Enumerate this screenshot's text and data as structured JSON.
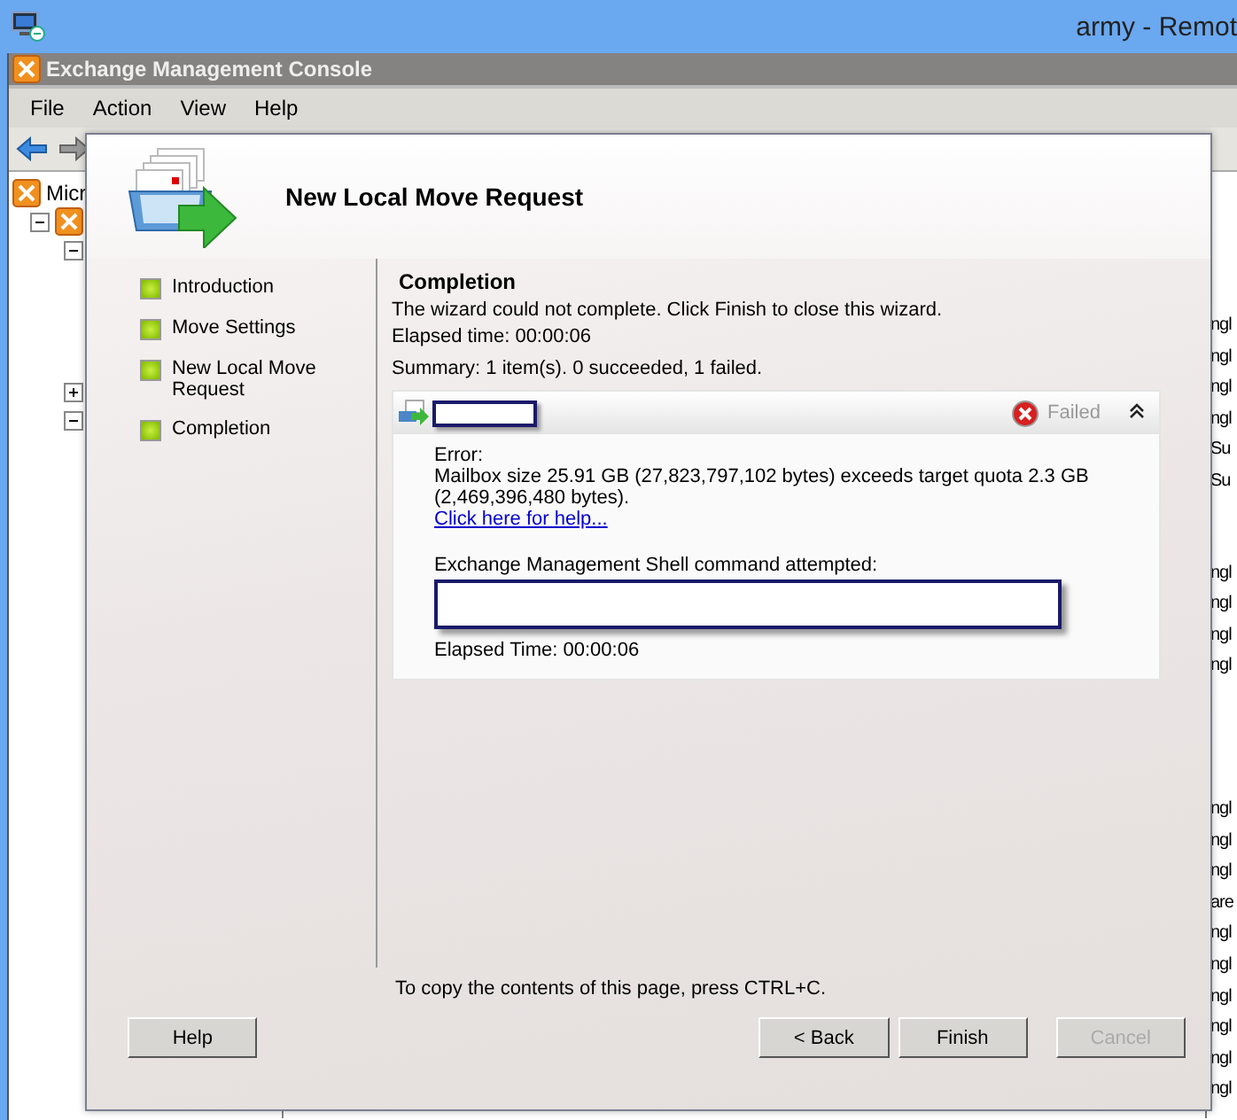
{
  "remote": {
    "title": "army - Remot"
  },
  "console": {
    "title": "Exchange Management Console",
    "menu": [
      "File",
      "Action",
      "View",
      "Help"
    ],
    "tree": {
      "label": "Micr",
      "children": [
        {
          "expanded": true,
          "children": [
            {
              "expanded": true
            },
            {
              "expanded": false
            },
            {
              "expanded": true
            }
          ]
        }
      ]
    },
    "list_fragments": [
      [
        "ngl",
        "ngl",
        "ngl",
        "ngl",
        "Su",
        "Su"
      ],
      [
        "ngl",
        "ngl",
        "ngl",
        "ngl"
      ],
      [
        "ngl",
        "ngl",
        "ngl",
        "are",
        "ngl",
        "ngl",
        "ngl",
        "ngl",
        "ngl",
        "ngl"
      ]
    ]
  },
  "wizard": {
    "title": "New Local Move Request",
    "steps": [
      {
        "label": "Introduction"
      },
      {
        "label": "Move Settings"
      },
      {
        "label": "New Local Move Request"
      },
      {
        "label": "Completion"
      }
    ],
    "heading": "Completion",
    "message": "The wizard could not complete. Click Finish to close this wizard.",
    "elapsed": "Elapsed time: 00:00:06",
    "summary": "Summary: 1 item(s). 0 succeeded, 1 failed.",
    "result": {
      "status": "Failed",
      "expanded": true,
      "error_label": "Error:",
      "error_text": "Mailbox size 25.91 GB (27,823,797,102 bytes) exceeds target quota 2.3 GB (2,469,396,480 bytes).",
      "help_link": "Click here for help...",
      "command_label": "Exchange Management Shell command attempted:",
      "elapsed": "Elapsed Time: 00:00:06"
    },
    "copy_hint": "To copy the contents of this page, press CTRL+C.",
    "buttons": [
      {
        "label": "Help",
        "disabled": false
      },
      {
        "label": "< Back",
        "disabled": false
      },
      {
        "label": "Finish",
        "disabled": false
      },
      {
        "label": "Cancel",
        "disabled": true
      }
    ]
  }
}
